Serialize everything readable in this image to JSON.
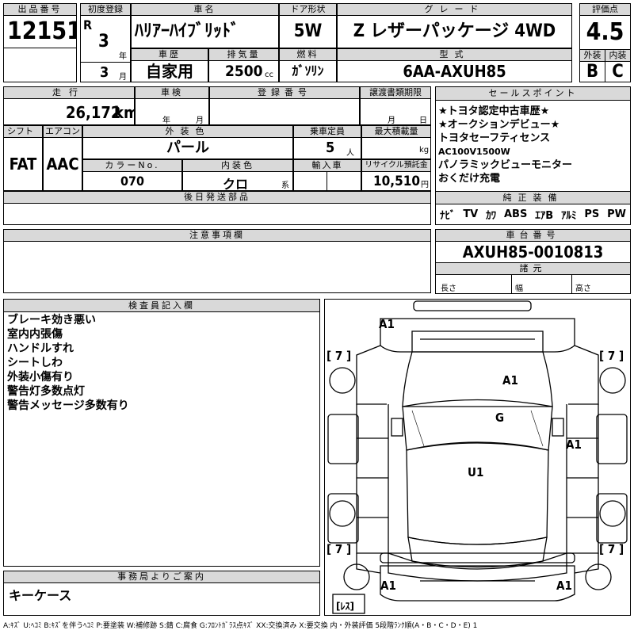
{
  "header": {
    "lot_label": "出品番号",
    "lot": "12151",
    "first_reg_label": "初度登録",
    "era": "R",
    "year": "3",
    "year_unit": "年",
    "month": "3",
    "month_unit": "月",
    "name_label": "車名",
    "name": "ﾊﾘｱｰﾊｲﾌﾞﾘｯﾄﾞ",
    "doors_label": "ドア形状",
    "doors": "5W",
    "grade_label": "グレード",
    "grade": "Z レザーパッケージ 4WD",
    "score_label": "評価点",
    "score": "4.5",
    "history_label": "車歴",
    "history": "自家用",
    "displacement_label": "排気量",
    "displacement": "2500",
    "displacement_unit": "cc",
    "fuel_label": "燃料",
    "fuel": "ｶﾞｿﾘﾝ",
    "model_label": "型式",
    "model": "6AA-AXUH85",
    "exterior_label": "外装",
    "exterior": "B",
    "interior_label": "内装",
    "interior": "C"
  },
  "row2": {
    "mileage_label": "走行",
    "mileage": "26,172",
    "mileage_unit": "km",
    "inspection_label": "車検",
    "insp_year_unit": "年",
    "insp_month_unit": "月",
    "reg_no_label": "登録番号",
    "transfer_label": "譲渡書類期限",
    "transfer_month_unit": "月",
    "transfer_day_unit": "日"
  },
  "row3": {
    "shift_label": "シフト",
    "shift": "FAT",
    "ac_label": "エアコン",
    "ac": "AAC",
    "color_label": "外装色",
    "color": "パール",
    "capacity_label": "乗車定員",
    "capacity": "5",
    "capacity_unit": "人",
    "load_label": "最大積載量",
    "load_unit": "kg",
    "color_no_label": "カラーNo.",
    "color_no": "070",
    "int_color_label": "内装色",
    "int_color": "クロ",
    "int_color_unit": "系",
    "import_label": "輸入車",
    "recycle_label": "リサイクル預託金",
    "recycle": "10,510",
    "recycle_unit": "円",
    "later_parts_label": "後日発送部品"
  },
  "sales_points": {
    "label": "セールスポイント",
    "lines": [
      "★トヨタ認定中古車歴★",
      "★オークションデビュー★",
      "トヨタセーフティセンス",
      "AC100V1500W",
      "パノラミックビューモニター",
      "おくだけ充電"
    ]
  },
  "equipment": {
    "label": "純正装備",
    "items": [
      "ﾅﾋﾞ",
      "TV",
      "ｶﾜ",
      "ABS",
      "ｴｱB",
      "ｱﾙﾐ",
      "PS",
      "PW"
    ]
  },
  "notes": {
    "label": "注意事項欄"
  },
  "chassis": {
    "label": "車台番号",
    "number": "AXUH85-0010813",
    "specs_label": "諸元",
    "length_label": "長さ",
    "width_label": "幅",
    "height_label": "高さ"
  },
  "inspector": {
    "label": "検査員記入欄",
    "lines": [
      "ブレーキ効き悪い",
      "室内内張傷",
      "ハンドルすれ",
      "シートしわ",
      "外装小傷有り",
      "警告灯多数点灯",
      "警告メッセージ多数有り"
    ]
  },
  "office": {
    "label": "事務局よりご案内",
    "text": "キーケース"
  },
  "diagram": {
    "marks": [
      "A1",
      "A1",
      "G",
      "A1",
      "U1",
      "A1",
      "A1"
    ],
    "tires": [
      "[ 7 ]",
      "[ 7 ]",
      "[ 7 ]",
      "[ 7 ]"
    ],
    "spare": "[ﾚｽ]"
  },
  "legend": "A:ｷｽﾞ U:ﾍｺﾐ B:ｷｽﾞを伴うﾍｺﾐ P:要塗装 W:補修跡 S:錆 C:腐食 G:ﾌﾛﾝﾄｶﾞﾗｽ点ｷｽﾞ XX:交換済み X:要交換 内・外装評価 5段階ﾗﾝｸ順(A・B・C・D・E) 1"
}
